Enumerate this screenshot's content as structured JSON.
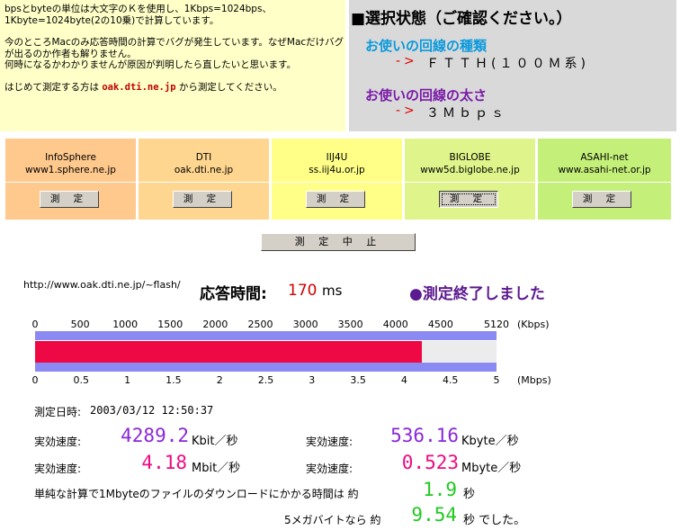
{
  "note": {
    "line1": "bpsとbyteの単位は大文字のＫを使用し、1Kbps=1024bps、",
    "line2": "1Kbyte=1024byte(2の10乗)で計算しています。",
    "para2": "今のところMacのみ応答時間の計算でバグが発生しています。なぜMacだけバグが出るのか作者も解りません。\n何時になるかわかりませんが原因が判明したら直したいと思います。",
    "para3_pre": "はじめて測定する方は ",
    "para3_domain": "oak.dti.ne.jp",
    "para3_post": " から測定してください。"
  },
  "selection": {
    "title": "■選択状態（ご確認ください。）",
    "line_type_label": "お使いの回線の種類",
    "line_type_arrow": "->",
    "line_type_value": "ＦＴＴＨ(１００Ｍ系)",
    "line_speed_label": "お使いの回線の太さ",
    "line_speed_arrow": "->",
    "line_speed_value": "３Ｍｂｐｓ"
  },
  "isps": [
    {
      "name": "InfoSphere",
      "host": "www1.sphere.ne.jp",
      "button": "測 定",
      "color": "#ffc88c"
    },
    {
      "name": "DTI",
      "host": "oak.dti.ne.jp",
      "button": "測 定",
      "color": "#ffd68f"
    },
    {
      "name": "IIJ4U",
      "host": "ss.iij4u.or.jp",
      "button": "測 定",
      "color": "#ffff88"
    },
    {
      "name": "BIGLOBE",
      "host": "www5d.biglobe.ne.jp",
      "button": "測 定",
      "color": "#dff48a"
    },
    {
      "name": "ASAHI-net",
      "host": "www.asahi-net.or.jp",
      "button": "測 定",
      "color": "#c4f07a"
    }
  ],
  "stop_button": "測 定 中 止",
  "result": {
    "url": "http://www.oak.dti.ne.jp/~flash/",
    "response_label": "応答時間:",
    "response_value": "170",
    "response_unit": "ms",
    "status": "●測定終了しました"
  },
  "gauge": {
    "kbps_ticks": [
      "0",
      "500",
      "1000",
      "1500",
      "2000",
      "2500",
      "3000",
      "3500",
      "4000",
      "4500",
      "5120"
    ],
    "kbps_unit": "(Kbps)",
    "mbps_ticks": [
      "0",
      "0.5",
      "1",
      "1.5",
      "2",
      "2.5",
      "3",
      "3.5",
      "4",
      "4.5",
      "5"
    ],
    "mbps_unit": "(Mbps)",
    "measured_kbit": 4289.2,
    "max_kbit": 5120,
    "fill_color": "#ee0844",
    "accent_color": "#8a8af2"
  },
  "stats": {
    "date_label": "測定日時:",
    "date_value": "2003/03/12 12:50:37",
    "eff_label": "実効速度:",
    "kbit_value": "4289.2",
    "kbit_unit": "Kbit／秒",
    "kbyte_value": "536.16",
    "kbyte_unit": "Kbyte／秒",
    "mbit_value": "4.18",
    "mbit_unit": "Mbit／秒",
    "mbyte_value": "0.523",
    "mbyte_unit": "Mbyte／秒",
    "dl_label": "単純な計算で1Mbyteのファイルのダウンロードにかかる時間は 約",
    "dl_value": "1.9",
    "dl_unit": "秒",
    "dl5_label": "5メガバイトなら 約",
    "dl5_value": "9.54",
    "dl5_unit": "秒 でした。"
  }
}
